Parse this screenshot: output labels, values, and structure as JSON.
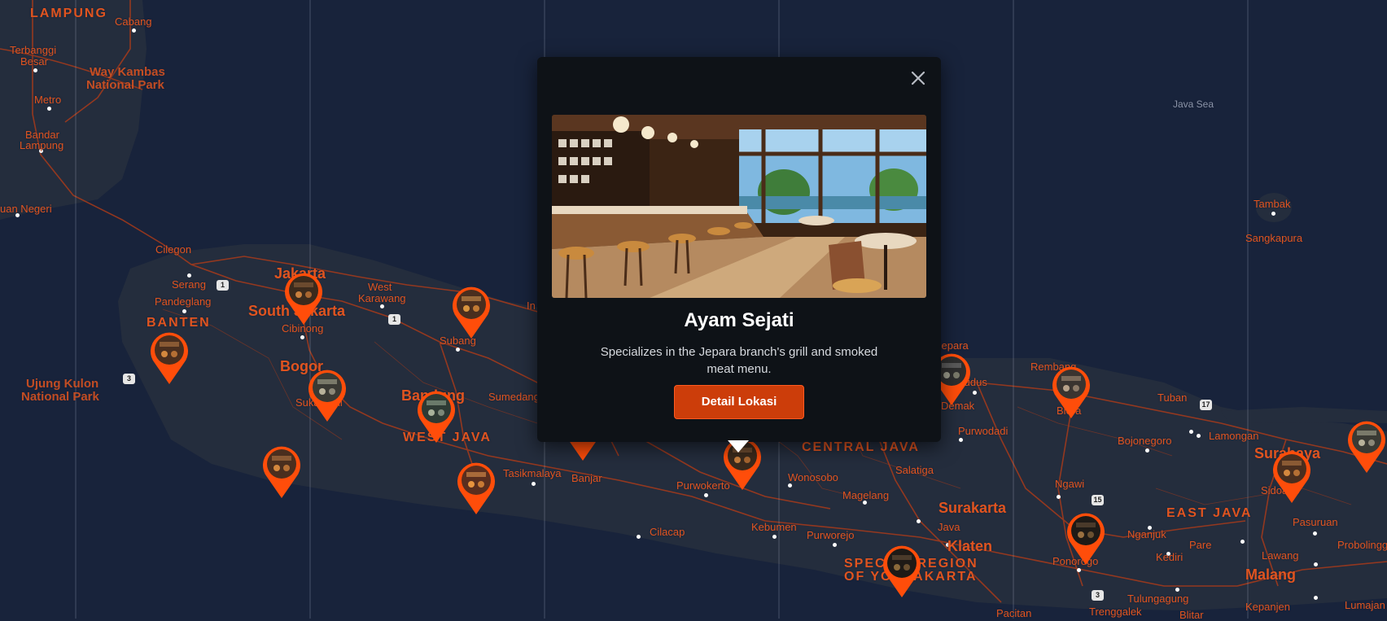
{
  "map": {
    "labels": {
      "lampung": "LAMPUNG",
      "cabang": "Cabang",
      "terbanggi": "Terbanggi",
      "besar": "Besar",
      "way_kambas_1": "Way Kambas",
      "way_kambas_2": "National Park",
      "metro": "Metro",
      "bandar_1": "Bandar",
      "bandar_2": "Lampung",
      "negeri": "uan Negeri",
      "cilegon": "Cilegon",
      "serang": "Serang",
      "pandeglang": "Pandeglang",
      "banten": "BANTEN",
      "ujung_1": "Ujung Kulon",
      "ujung_2": "National Park",
      "jakarta": "Jakarta",
      "south_jakarta": "South Jakarta",
      "cibinong": "Cibinong",
      "bogor": "Bogor",
      "sukabumi": "Sukabumi",
      "west_karawang_1": "West",
      "west_karawang_2": "Karawang",
      "subang": "Subang",
      "indramayu": "In",
      "bandung": "Bandung",
      "sumedang": "Sumedang",
      "west_java": "WEST JAVA",
      "tasikmalaya": "Tasikmalaya",
      "banjar": "Banjar",
      "purwokerto": "Purwokerto",
      "cilacap": "Cilacap",
      "kebumen": "Kebumen",
      "purworejo": "Purworejo",
      "wonosobo": "Wonosobo",
      "magelang": "Magelang",
      "central_java": "CENTRAL JAVA",
      "salatiga": "Salatiga",
      "surakarta": "Surakarta",
      "java": "Java",
      "klaten": "Klaten",
      "special_region_1": "SPECIAL REGION",
      "special_region_2": "OF YOGYAKARTA",
      "jepara": "Jepara",
      "kudus": "Kudus",
      "demak": "Demak",
      "purwodadi": "Purwodadi",
      "rembang": "Rembang",
      "blora": "Blora",
      "tuban": "Tuban",
      "bojonegoro": "Bojonegoro",
      "lamongan": "Lamongan",
      "ngawi": "Ngawi",
      "east_java": "EAST JAVA",
      "nganjuk": "Nganjuk",
      "kediri": "Kediri",
      "pare": "Pare",
      "ponorogo": "Ponorogo",
      "madiun": "Madiun",
      "tulungagung": "Tulungagung",
      "trenggalek": "Trenggalek",
      "blitar": "Blitar",
      "pacitan": "Pacitan",
      "kepanjen": "Kepanjen",
      "malang": "Malang",
      "lawang": "Lawang",
      "pasuruan": "Pasuruan",
      "probolinggo": "Probolingg",
      "lumajang": "Lumajan",
      "surabaya": "Surabaya",
      "sidoarjo": "Sidoarjo",
      "tambak": "Tambak",
      "sangkapura": "Sangkapura",
      "java_sea": "Java Sea"
    },
    "shields": [
      "1",
      "1",
      "3",
      "17",
      "15",
      "3"
    ],
    "colors": {
      "background": "#18233b",
      "land": "#242d3d",
      "roads": "#a83a1a",
      "labels": "#e0541f",
      "pin": "#ff4d0a"
    }
  },
  "popup": {
    "title": "Ayam Sejati",
    "description": "Specializes in the Jepara branch's grill and smoked meat menu.",
    "button_label": "Detail Lokasi",
    "close_icon": "close-icon",
    "image_icon": "cafe-interior-photo"
  }
}
